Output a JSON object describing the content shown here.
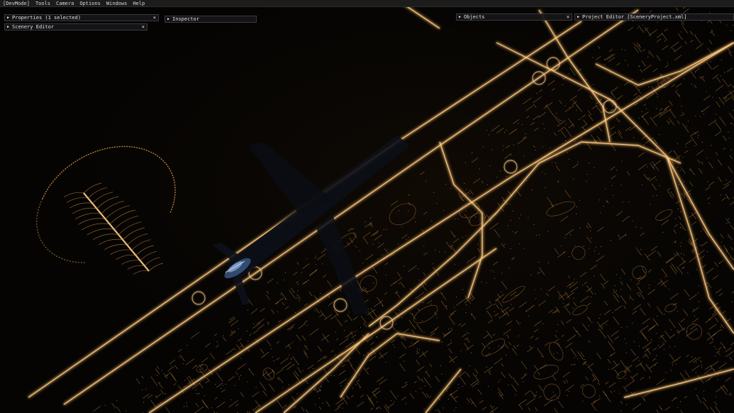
{
  "menu": {
    "items": [
      "[DevMode]",
      "Tools",
      "Camera",
      "Options",
      "Windows",
      "Help"
    ]
  },
  "panels": {
    "properties": {
      "title": "Properties (1 selected)",
      "close": "×"
    },
    "scenery_editor": {
      "title": "Scenery Editor",
      "close": "×"
    },
    "inspector": {
      "title": "Inspector",
      "close": ""
    },
    "objects": {
      "title": "Objects",
      "close": "×"
    },
    "project_editor": {
      "title": "Project Editor [SceneryProject.xml]",
      "close": ""
    }
  },
  "icons": {
    "expand": "play-triangle-icon",
    "close": "close-x-icon"
  },
  "colors": {
    "menubar_bg": "#1c1c1c",
    "panel_bg": "#161618",
    "city_light": "#e8a04a",
    "city_light_bright": "#ffd089",
    "ground": "#050403"
  }
}
